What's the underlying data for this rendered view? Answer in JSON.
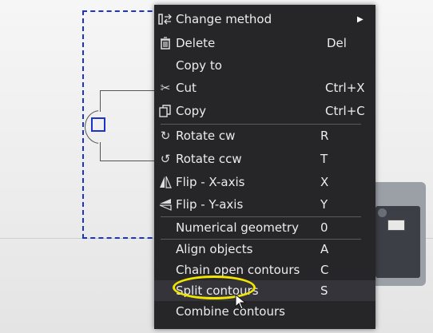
{
  "context_menu": {
    "items": [
      {
        "label": "Change method",
        "shortcut": "",
        "icon": "method-icon",
        "submenu": true
      },
      {
        "label": "Delete",
        "shortcut": "Del",
        "icon": "trash-icon"
      },
      {
        "label": "Copy to",
        "shortcut": "",
        "icon": ""
      },
      {
        "label": "Cut",
        "shortcut": "Ctrl+X",
        "icon": "scissors-icon"
      },
      {
        "label": "Copy",
        "shortcut": "Ctrl+C",
        "icon": "copy-icon"
      },
      {
        "label": "Rotate cw",
        "shortcut": "R",
        "icon": "rotate-cw-icon"
      },
      {
        "label": "Rotate ccw",
        "shortcut": "T",
        "icon": "rotate-ccw-icon"
      },
      {
        "label": "Flip - X-axis",
        "shortcut": "X",
        "icon": "flip-x-icon"
      },
      {
        "label": "Flip - Y-axis",
        "shortcut": "Y",
        "icon": "flip-y-icon"
      },
      {
        "label": "Numerical geometry",
        "shortcut": "0",
        "icon": ""
      },
      {
        "label": "Align objects",
        "shortcut": "A",
        "icon": ""
      },
      {
        "label": "Chain open contours",
        "shortcut": "C",
        "icon": ""
      },
      {
        "label": "Split contours",
        "shortcut": "S",
        "icon": "",
        "hovered": true
      },
      {
        "label": "Combine contours",
        "shortcut": "",
        "icon": ""
      }
    ]
  },
  "colors": {
    "menu_bg": "#262629",
    "selection": "#1b33c8",
    "highlight_ellipse": "#f2e600"
  }
}
